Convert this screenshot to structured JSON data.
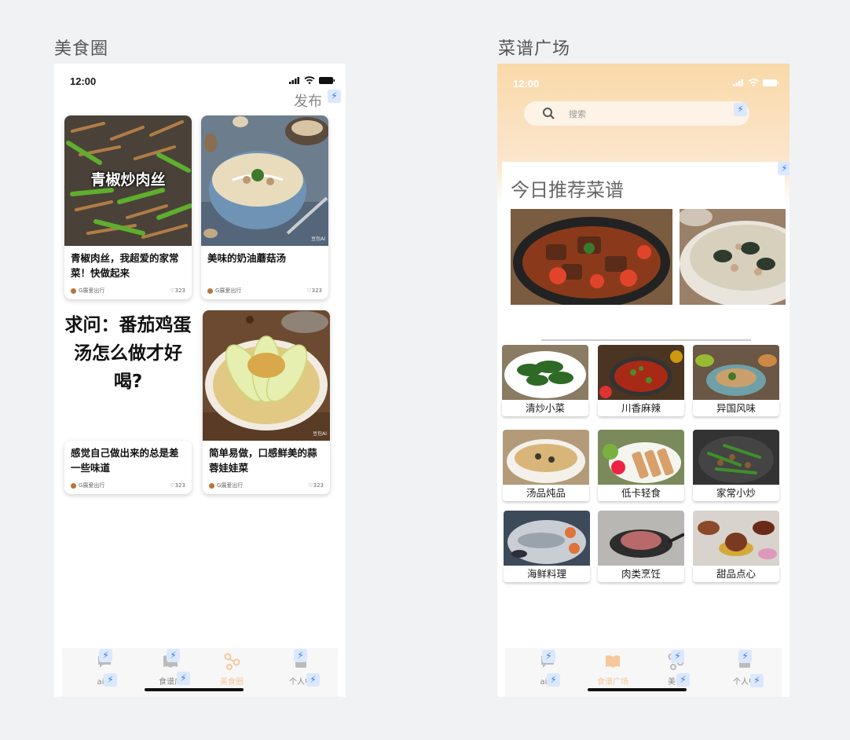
{
  "frames": {
    "left_title": "美食圈",
    "right_title": "菜谱广场"
  },
  "status": {
    "time": "12:00"
  },
  "feed": {
    "publish_label": "发布",
    "posts": [
      {
        "title": "青椒肉丝，我超爱的家常菜！快做起来",
        "image_caption": "青椒炒肉丝",
        "author": "G展爱出行",
        "likes": "323"
      },
      {
        "title": "美味的奶油蘑菇汤",
        "author": "G展爱出行",
        "likes": "323",
        "watermark": "豆包AI"
      },
      {
        "title": "感觉自己做出来的总是差一些味道",
        "question": "求问：番茄鸡蛋汤怎么做才好喝?",
        "author": "G展爱出行",
        "likes": "323"
      },
      {
        "title": "简单易做，口感鲜美的蒜蓉娃娃菜",
        "author": "G展爱出行",
        "likes": "323",
        "watermark": "豆包AI"
      }
    ]
  },
  "recipes": {
    "search_placeholder": "搜索",
    "today_title": "今日推荐菜谱",
    "categories": [
      "清炒小菜",
      "川香麻辣",
      "异国风味",
      "汤品炖品",
      "低卡轻食",
      "家常小炒",
      "海鲜料理",
      "肉类烹饪",
      "甜品点心"
    ]
  },
  "tabbar_left": {
    "tabs": [
      "ai问",
      "食谱广场",
      "美食圈",
      "个人中心"
    ],
    "visible": [
      "ai问",
      "食谱广",
      "美食圈",
      "个人中"
    ]
  },
  "tabbar_right": {
    "visible": [
      "ai问",
      "食谱广场",
      "美食",
      "个人中"
    ]
  },
  "colors": {
    "accent": "#f0a45a",
    "active_tab": "#f6c79a",
    "bolt": "#2f7bf5",
    "header_gradient_top": "#f9d9a9"
  }
}
